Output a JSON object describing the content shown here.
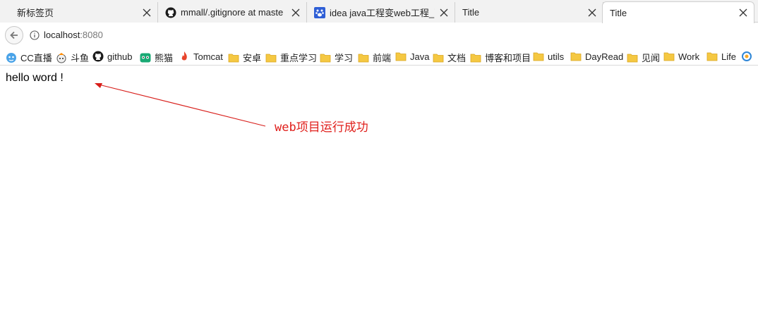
{
  "tabs": [
    {
      "label": "新标签页",
      "icon": "none",
      "active": false
    },
    {
      "label": "mmall/.gitignore at maste",
      "icon": "github-icon",
      "active": false
    },
    {
      "label": "idea java工程变web工程_百",
      "icon": "baidu-paw-icon",
      "active": false
    },
    {
      "label": "Title",
      "icon": "none",
      "active": false
    },
    {
      "label": "Title",
      "icon": "none",
      "active": true
    }
  ],
  "address_bar": {
    "host": "localhost",
    "port": ":8080"
  },
  "bookmarks": [
    {
      "label": "CC直播",
      "icon": "cc-live-icon"
    },
    {
      "label": "斗鱼",
      "icon": "douyu-icon"
    },
    {
      "label": "github",
      "icon": "github-icon"
    },
    {
      "label": "熊猫",
      "icon": "panda-icon"
    },
    {
      "label": "Tomcat",
      "icon": "tomcat-icon"
    },
    {
      "label": "安卓",
      "icon": "folder-icon"
    },
    {
      "label": "重点学习",
      "icon": "folder-icon"
    },
    {
      "label": "学习",
      "icon": "folder-icon"
    },
    {
      "label": "前端",
      "icon": "folder-icon"
    },
    {
      "label": "Java",
      "icon": "folder-icon"
    },
    {
      "label": "文档",
      "icon": "folder-icon"
    },
    {
      "label": "博客和项目",
      "icon": "folder-icon"
    },
    {
      "label": "utils",
      "icon": "folder-icon"
    },
    {
      "label": "DayRead",
      "icon": "folder-icon"
    },
    {
      "label": "见闻",
      "icon": "folder-icon"
    },
    {
      "label": "Work",
      "icon": "folder-icon"
    },
    {
      "label": "Life",
      "icon": "folder-icon"
    },
    {
      "label": "",
      "icon": "swirl-icon"
    }
  ],
  "page": {
    "body_text": "hello word !",
    "annotation": "web项目运行成功"
  },
  "colors": {
    "annotation": "#e0201c",
    "folder": "#f5c842"
  }
}
